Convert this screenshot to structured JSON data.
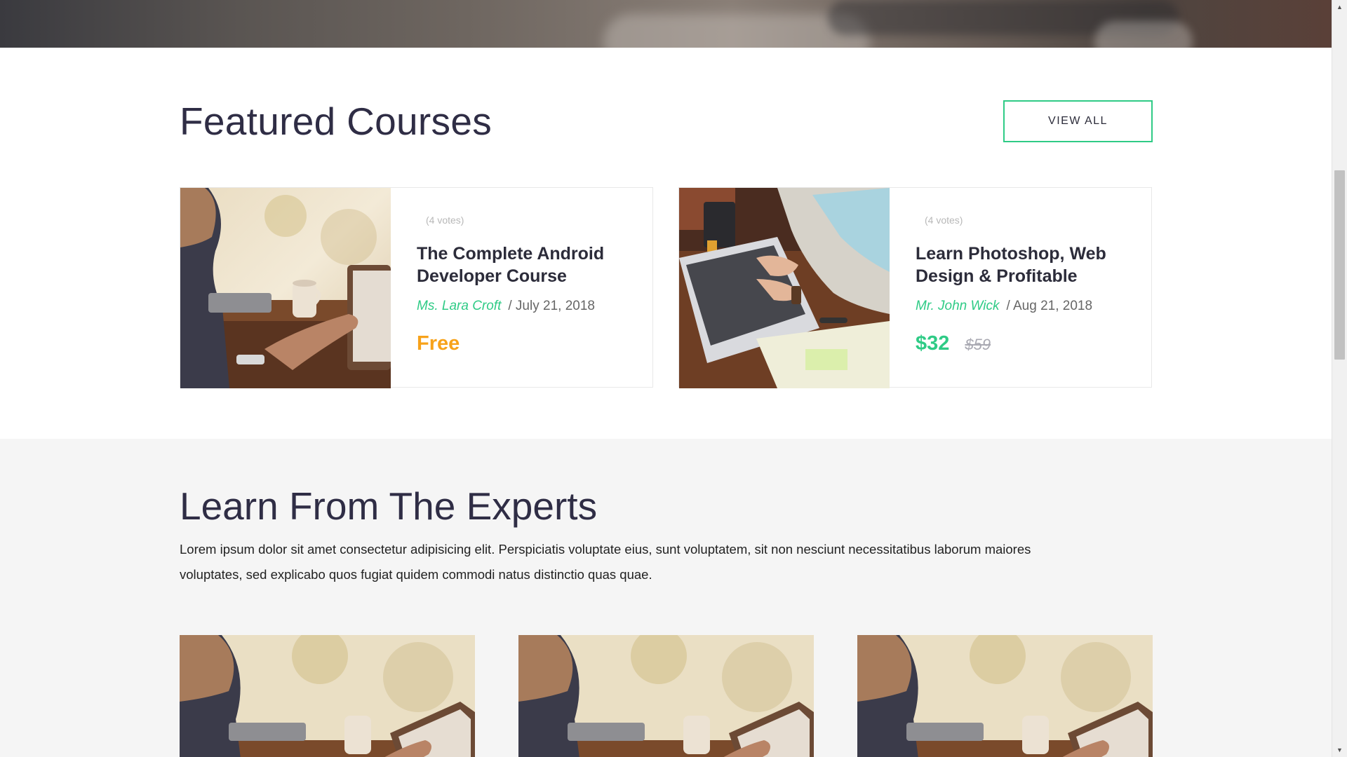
{
  "featured": {
    "title": "Featured Courses",
    "view_all_label": "VIEW ALL",
    "courses": [
      {
        "votes": "(4 votes)",
        "title": "The Complete Android Developer Course",
        "author": "Ms. Lara Croft",
        "date": "/ July 21, 2018",
        "price": "Free",
        "image": "man-with-tablet-photo"
      },
      {
        "votes": "(4 votes)",
        "title": "Learn Photoshop, Web Design & Profitable",
        "author": "Mr. John Wick",
        "date": "/ Aug 21, 2018",
        "price": "$32",
        "old_price": "$59",
        "image": "laptop-typing-photo"
      }
    ]
  },
  "experts": {
    "title": "Learn From The Experts",
    "description": "Lorem ipsum dolor sit amet consectetur adipisicing elit. Perspiciatis voluptate eius, sunt voluptatem, sit non nesciunt necessitatibus laborum maiores voluptates, sed explicabo quos fugiat quidem commodi natus distinctio quas quae.",
    "cards": [
      {
        "image": "man-with-tablet-photo"
      },
      {
        "image": "man-with-tablet-photo"
      },
      {
        "image": "man-with-tablet-photo"
      }
    ]
  },
  "colors": {
    "accent_green": "#2fcb86",
    "free_orange": "#f7a21a",
    "heading": "#2f2d45"
  },
  "scrollbar": {
    "up_icon": "arrow-up-icon",
    "down_icon": "arrow-down-icon"
  }
}
